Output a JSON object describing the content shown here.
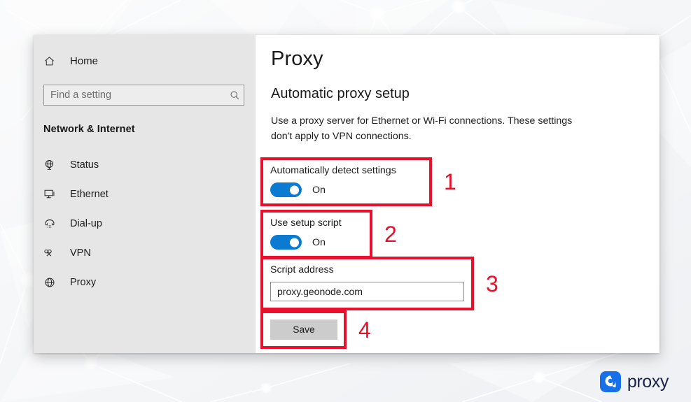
{
  "window": {
    "sidebar": {
      "home": {
        "label": "Home",
        "icon": "home-icon"
      },
      "search": {
        "placeholder": "Find a setting",
        "value": "",
        "icon": "search-icon"
      },
      "heading": "Network & Internet",
      "items": [
        {
          "label": "Status",
          "icon": "globe-status-icon"
        },
        {
          "label": "Ethernet",
          "icon": "ethernet-icon"
        },
        {
          "label": "Dial-up",
          "icon": "dialup-icon"
        },
        {
          "label": "VPN",
          "icon": "vpn-icon"
        },
        {
          "label": "Proxy",
          "icon": "globe-icon"
        }
      ]
    },
    "main": {
      "page_title": "Proxy",
      "section_title": "Automatic proxy setup",
      "description": "Use a proxy server for Ethernet or Wi-Fi connections. These settings don't apply to VPN connections.",
      "auto_detect": {
        "label": "Automatically detect settings",
        "state": "On",
        "annotation": "1"
      },
      "use_setup_script": {
        "label": "Use setup script",
        "state": "On",
        "annotation": "2"
      },
      "script_address": {
        "label": "Script address",
        "value": "proxy.geonode.com",
        "placeholder": "",
        "annotation": "3"
      },
      "save": {
        "label": "Save",
        "annotation": "4"
      }
    }
  },
  "brand": {
    "name": "proxy",
    "mark_icon": "proxy-logo-icon",
    "accent_color": "#1770e8",
    "wordmark_color": "#1b2447"
  },
  "colors": {
    "annotation_red": "#e8112d",
    "toggle_on_blue": "#0a7bd1",
    "sidebar_bg": "#e6e6e6",
    "window_bg": "#ffffff"
  }
}
